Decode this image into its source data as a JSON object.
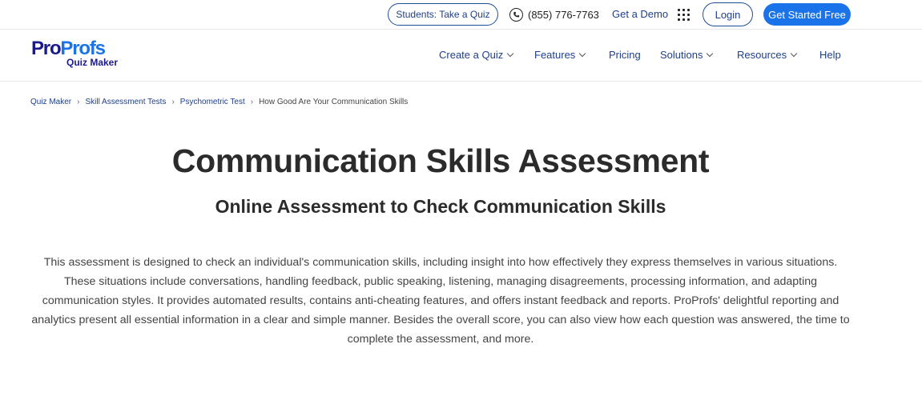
{
  "topbar": {
    "students_button": "Students: Take a Quiz",
    "phone": "(855) 776-7763",
    "get_demo": "Get a Demo",
    "login": "Login",
    "get_started": "Get Started Free"
  },
  "logo": {
    "brand_part1": "Pro",
    "brand_part2": "Profs",
    "product": "Quiz Maker"
  },
  "nav": {
    "create_quiz": "Create a Quiz",
    "features": "Features",
    "pricing": "Pricing",
    "solutions": "Solutions",
    "resources": "Resources",
    "help": "Help"
  },
  "breadcrumb": [
    "Quiz Maker",
    "Skill Assessment Tests",
    "Psychometric Test",
    "How Good Are Your Communication Skills"
  ],
  "page": {
    "title": "Communication Skills Assessment",
    "subtitle": "Online Assessment to Check Communication Skills",
    "description": "This assessment is designed to check an individual's communication skills, including insight into how effectively they express themselves in various situations. These situations include conversations, handling feedback, public speaking, listening, managing disagreements, processing information, and adapting communication styles. It provides automated results, contains anti-cheating features, and offers instant feedback and reports. ProProfs' delightful reporting and analytics present all essential information in a clear and simple manner. Besides the overall score, you can also view how each question was answered, the time to complete the assessment, and more."
  },
  "colors": {
    "brand_dark": "#1a1a8c",
    "brand_blue": "#1a73e8",
    "link": "#1f3f8a"
  }
}
